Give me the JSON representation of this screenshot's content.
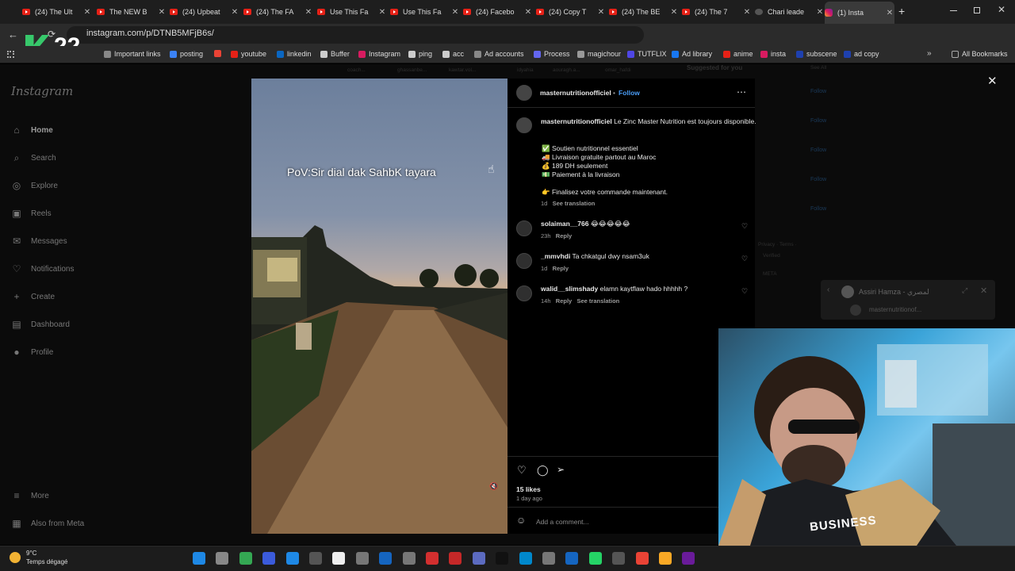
{
  "browser": {
    "tabs": [
      {
        "title": "(24) The Ult",
        "icon": "youtube"
      },
      {
        "title": "The NEW B",
        "icon": "youtube"
      },
      {
        "title": "(24) Upbeat",
        "icon": "youtube"
      },
      {
        "title": "(24) The FA",
        "icon": "youtube"
      },
      {
        "title": "Use This Fa",
        "icon": "youtube"
      },
      {
        "title": "Use This Fa",
        "icon": "youtube"
      },
      {
        "title": "(24) Facebo",
        "icon": "youtube"
      },
      {
        "title": "(24) Copy T",
        "icon": "youtube"
      },
      {
        "title": "(24) The BE",
        "icon": "youtube"
      },
      {
        "title": "(24) The 7",
        "icon": "youtube"
      },
      {
        "title": "Chari leade",
        "icon": "ghost"
      },
      {
        "title": "(1) Insta",
        "icon": "instagram",
        "active": true
      }
    ],
    "new_tab": "+",
    "url": "instagram.com/p/DTNB5MFjB6s/",
    "bookmarks": [
      {
        "label": "Important links",
        "color": "#888888"
      },
      {
        "label": "posting",
        "color": "#3b82f6"
      },
      {
        "label": "",
        "color": "#ea4335"
      },
      {
        "label": "youtube",
        "color": "#e62117"
      },
      {
        "label": "linkedin",
        "color": "#0a66c2"
      },
      {
        "label": "Buffer",
        "color": "#cccccc"
      },
      {
        "label": "Instagram",
        "color": "#d81b60"
      },
      {
        "label": "ping",
        "color": "#cccccc"
      },
      {
        "label": "acc",
        "color": "#cccccc"
      },
      {
        "label": "Ad accounts",
        "color": "#888888"
      },
      {
        "label": "Process",
        "color": "#6366f1"
      },
      {
        "label": "magichour",
        "color": "#999999"
      },
      {
        "label": "TUTFLIX",
        "color": "#4f46e5"
      },
      {
        "label": "Ad library",
        "color": "#1877f2"
      },
      {
        "label": "anime",
        "color": "#e62117"
      },
      {
        "label": "insta",
        "color": "#d81b60"
      },
      {
        "label": "subscene",
        "color": "#1e40af"
      },
      {
        "label": "ad copy",
        "color": "#1e40af"
      }
    ],
    "all_bookmarks": "All Bookmarks"
  },
  "watermark": "22",
  "instagram": {
    "logo": "Instagram",
    "nav": [
      {
        "label": "Home",
        "icon": "home-icon"
      },
      {
        "label": "Search",
        "icon": "search-icon"
      },
      {
        "label": "Explore",
        "icon": "explore-icon"
      },
      {
        "label": "Reels",
        "icon": "reels-icon"
      },
      {
        "label": "Messages",
        "icon": "messages-icon"
      },
      {
        "label": "Notifications",
        "icon": "heart-icon"
      },
      {
        "label": "Create",
        "icon": "plus-icon"
      },
      {
        "label": "Dashboard",
        "icon": "dashboard-icon"
      },
      {
        "label": "Profile",
        "icon": "avatar"
      }
    ],
    "more": "More",
    "also_from_meta": "Also from Meta",
    "suggested_for_you": "Suggested for you",
    "see_all": "See All",
    "follow_ghost": "Follow",
    "footer_ghost": "Privacy · Terms ·",
    "meta_ghost": "META",
    "verified_ghost": "Verified",
    "suggest_names": [
      "coach...",
      "ghassanbe...",
      "kawtar.vol...",
      "idyahia",
      "aouragh.a...",
      "omar_hafdi"
    ]
  },
  "post": {
    "video_caption": "PoV:Sir dial dak SahbK tayara",
    "username": "masternutritionofficiel",
    "follow": "Follow",
    "caption_user": "masternutritionofficiel",
    "caption_text": "Le Zinc Master Nutrition est toujours disponible.",
    "bullets": [
      {
        "emoji": "✅",
        "text": "Soutien nutritionnel essentiel"
      },
      {
        "emoji": "🚚",
        "text": "Livraison gratuite partout au Maroc"
      },
      {
        "emoji": "💰",
        "text": "189 DH seulement"
      },
      {
        "emoji": "💵",
        "text": "Paiement à la livraison"
      }
    ],
    "cta": {
      "emoji": "👉",
      "text": "Finalisez votre commande maintenant."
    },
    "caption_time": "1d",
    "see_translation": "See translation",
    "comments": [
      {
        "user": "solaiman__766",
        "text": "😂😂😂😂😂",
        "time": "23h",
        "reply": "Reply",
        "translate": ""
      },
      {
        "user": "_mmvhdi",
        "text": "Ta chkatgul dwy nsam3uk",
        "time": "1d",
        "reply": "Reply",
        "translate": ""
      },
      {
        "user": "walid__slimshady",
        "text": "elamn kaytflaw hado hhhhh ?",
        "time": "14h",
        "reply": "Reply",
        "translate": "See translation"
      }
    ],
    "likes": "15 likes",
    "posted": "1 day ago",
    "add_comment": "Add a comment..."
  },
  "popup": {
    "name": "Assiri Hamza - لمصري",
    "sub": "masternutritionof..."
  },
  "webcam": {
    "shirt_text": "BUSINESS"
  },
  "taskbar": {
    "temp": "9°C",
    "weather": "Temps dégagé"
  }
}
